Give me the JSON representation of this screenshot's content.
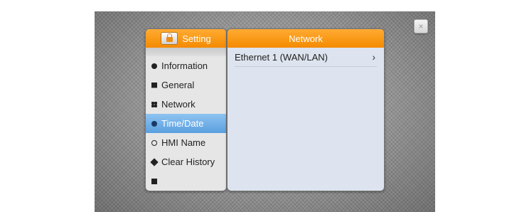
{
  "side": {
    "title": "Setting",
    "items": [
      {
        "label": "Information",
        "icon": "info-icon",
        "active": false
      },
      {
        "label": "General",
        "icon": "general-icon",
        "active": false
      },
      {
        "label": "Network",
        "icon": "network-icon",
        "active": false
      },
      {
        "label": "Time/Date",
        "icon": "clock-icon",
        "active": true
      },
      {
        "label": "HMI Name",
        "icon": "hmi-icon",
        "active": false
      },
      {
        "label": "Clear History",
        "icon": "eraser-icon",
        "active": false
      }
    ]
  },
  "main": {
    "title": "Network",
    "rows": [
      {
        "label": "Ethernet 1 (WAN/LAN)",
        "chevron": "›"
      }
    ]
  },
  "close": {
    "glyph": "×"
  },
  "colors": {
    "header": "#f48a00",
    "active": "#5a9fe0",
    "panel": "#dde4ef"
  }
}
